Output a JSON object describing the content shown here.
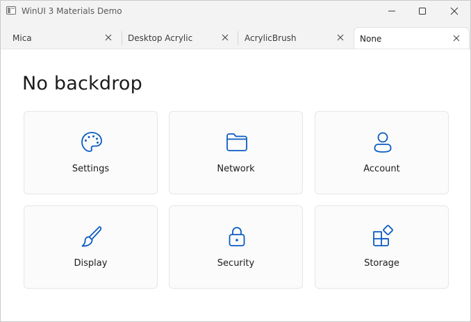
{
  "window": {
    "title": "WinUI 3 Materials Demo"
  },
  "tabs": [
    {
      "label": "Mica",
      "selected": false
    },
    {
      "label": "Desktop Acrylic",
      "selected": false
    },
    {
      "label": "AcrylicBrush",
      "selected": false
    },
    {
      "label": "None",
      "selected": true
    }
  ],
  "main": {
    "title": "No backdrop",
    "cards": [
      {
        "label": "Settings",
        "icon": "palette-icon"
      },
      {
        "label": "Network",
        "icon": "folder-icon"
      },
      {
        "label": "Account",
        "icon": "person-icon"
      },
      {
        "label": "Display",
        "icon": "brush-icon"
      },
      {
        "label": "Security",
        "icon": "lock-icon"
      },
      {
        "label": "Storage",
        "icon": "apps-add-icon"
      }
    ]
  },
  "colors": {
    "accent": "#0a5bc4",
    "content_background": "#ffffff",
    "chrome_background": "#f3f3f3"
  }
}
